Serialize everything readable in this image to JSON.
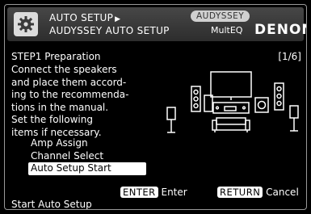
{
  "header": {
    "breadcrumb": "AUTO SETUP",
    "title": "AUDYSSEY AUTO SETUP",
    "audyssey_badge": "AUDYSSEY",
    "multeq": "MultEQ",
    "brand": "DENON"
  },
  "content": {
    "step_title": "STEP1 Preparation",
    "page_indicator": "[1/6]",
    "description": "Connect the speakers\nand place them accord-\ning to the recommenda-\ntions in the manual.\nSet the following\nitems if necessary."
  },
  "menu": {
    "items": [
      {
        "label": "Amp Assign"
      },
      {
        "label": "Channel Select"
      },
      {
        "label": "Auto Setup Start"
      }
    ],
    "selected_index": 2
  },
  "footer": {
    "enter_key": "ENTER",
    "enter_label": "Enter",
    "return_key": "RETURN",
    "return_label": "Cancel",
    "status": "Start Auto Setup"
  }
}
